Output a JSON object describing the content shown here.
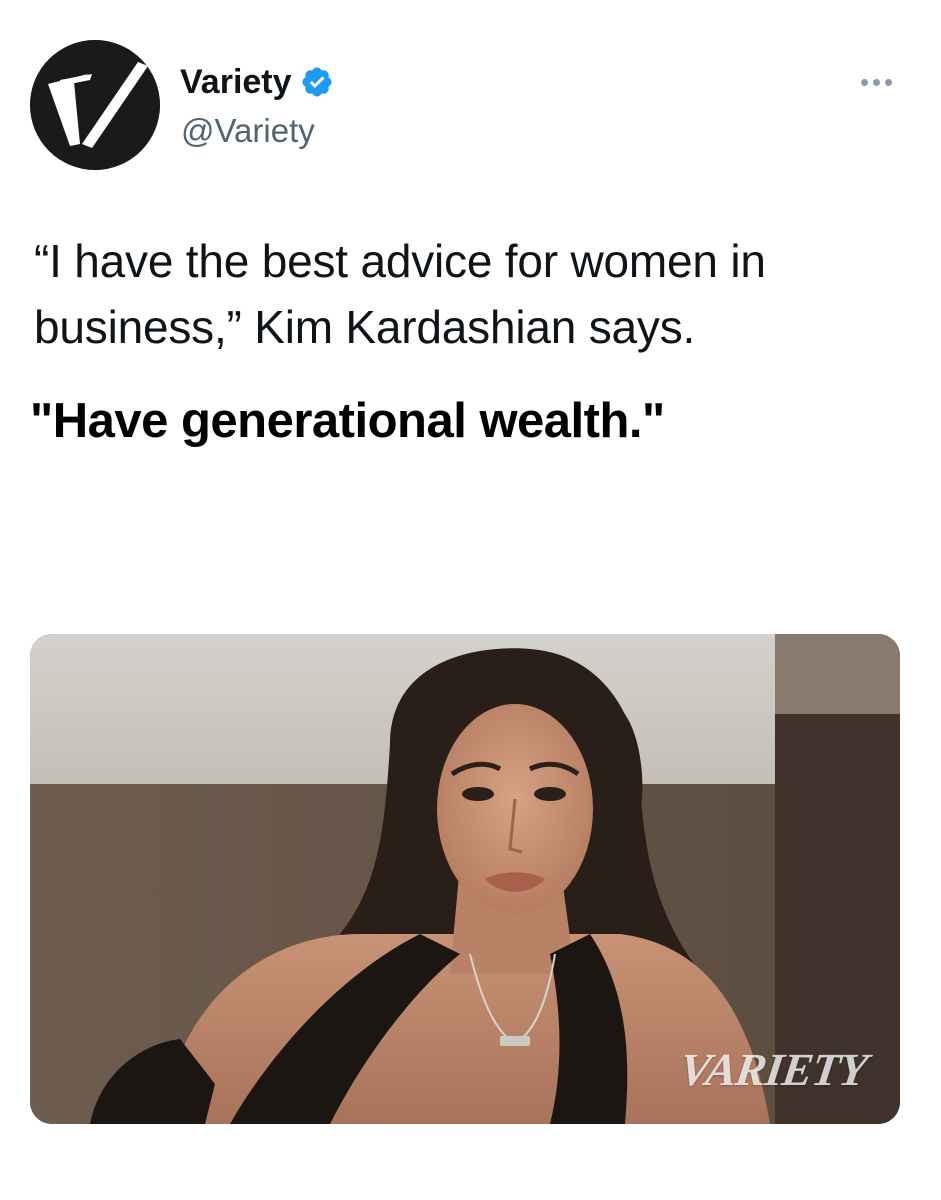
{
  "tweet": {
    "author": {
      "display_name": "Variety",
      "handle": "@Variety",
      "verified": true,
      "avatar_icon": "variety-v-logo",
      "avatar_color": "#1a1a1a"
    },
    "text": "“I have the best advice for women in business,” Kim Kardashian says.",
    "overlay_quote": "\"Have generational wealth.\"",
    "media": {
      "description_icon": "portrait-photo",
      "watermark": "VARIETY"
    }
  },
  "colors": {
    "verified": "#1d9bf0",
    "text_primary": "#0f1419",
    "text_secondary": "#536471",
    "more_dots": "#8b98a5"
  }
}
